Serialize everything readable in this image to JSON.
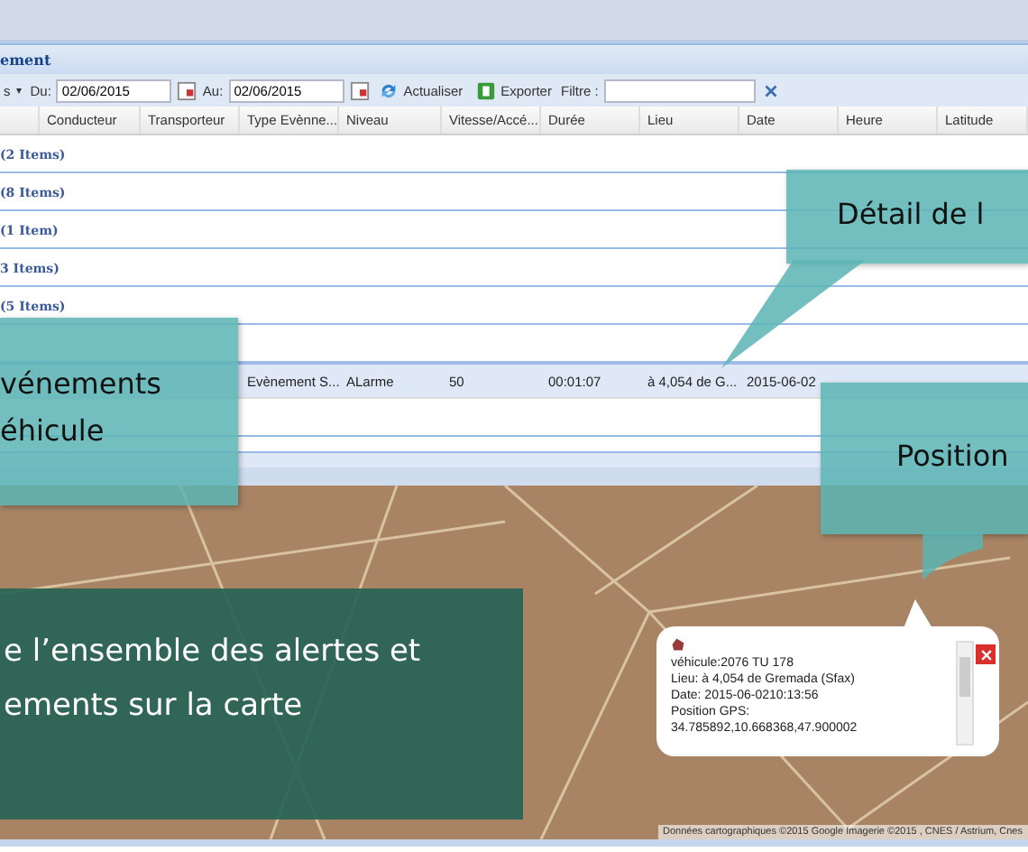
{
  "panel": {
    "title": "ement"
  },
  "toolbar": {
    "menu_label": "s",
    "menu_caret": "▾",
    "from_label": "Du:",
    "from_value": "02/06/2015",
    "to_label": "Au:",
    "to_value": "02/06/2015",
    "refresh_label": "Actualiser",
    "export_label": "Exporter",
    "filter_label": "Filtre :"
  },
  "table": {
    "columns": [
      "Conducteur",
      "Transporteur",
      "Type Evènne...",
      "Niveau",
      "Vitesse/Accé...",
      "Durée",
      "Lieu",
      "Date",
      "Heure",
      "Latitude"
    ],
    "rows": [
      {
        "kind": "group",
        "label": "(2 Items)"
      },
      {
        "kind": "group",
        "label": "(8 Items)"
      },
      {
        "kind": "group",
        "label": "(1 Item)"
      },
      {
        "kind": "group",
        "label": "3 Items)"
      },
      {
        "kind": "group",
        "label": "(5 Items)"
      },
      {
        "kind": "group"
      },
      {
        "kind": "data",
        "selected": true,
        "cells": [
          null,
          null,
          "Evènement S...",
          "ALarme",
          "50",
          "00:01:07",
          "à 4,054 de G...",
          "2015-06-02",
          null,
          null
        ]
      },
      {
        "kind": "group"
      }
    ]
  },
  "map": {
    "attribution": "Données cartographiques ©2015 Google Imagerie ©2015 , CNES / Astrium, Cnes",
    "popup": {
      "lines": [
        "véhicule:2076 TU 178",
        "Lieu: à 4,054 de Gremada (Sfax)",
        "Date: 2015-06-0210:13:56",
        "Position GPS:",
        "34.785892,10.668368,47.900002"
      ]
    }
  },
  "callouts": [
    {
      "kind": "teal",
      "lines": [
        "Détail de l"
      ]
    },
    {
      "kind": "teal",
      "lines": [
        "vénements",
        "éhicule"
      ]
    },
    {
      "kind": "teal",
      "lines": [
        "Position"
      ]
    },
    {
      "kind": "green",
      "lines": [
        "e  l’ensemble  des alertes et",
        "ements sur la carte"
      ]
    }
  ]
}
